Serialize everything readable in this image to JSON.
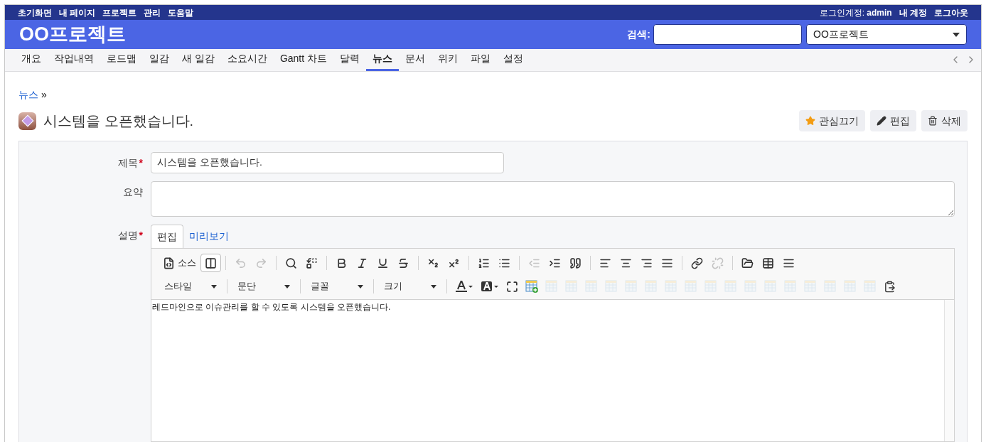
{
  "top_menu": {
    "items": [
      "초기화면",
      "내 페이지",
      "프로젝트",
      "관리",
      "도움말"
    ],
    "login_label": "로그인계정:",
    "login_user": "admin",
    "account_links": [
      "내 계정",
      "로그아웃"
    ]
  },
  "header": {
    "title": "OO프로젝트",
    "search_label": "검색:",
    "project_select": "OO프로젝트"
  },
  "tabs": [
    {
      "label": "개요",
      "selected": false
    },
    {
      "label": "작업내역",
      "selected": false
    },
    {
      "label": "로드맵",
      "selected": false
    },
    {
      "label": "일감",
      "selected": false
    },
    {
      "label": "새 일감",
      "selected": false
    },
    {
      "label": "소요시간",
      "selected": false
    },
    {
      "label": "Gantt 차트",
      "selected": false
    },
    {
      "label": "달력",
      "selected": false
    },
    {
      "label": "뉴스",
      "selected": true
    },
    {
      "label": "문서",
      "selected": false
    },
    {
      "label": "위키",
      "selected": false
    },
    {
      "label": "파일",
      "selected": false
    },
    {
      "label": "설정",
      "selected": false
    }
  ],
  "breadcrumb": {
    "link": "뉴스",
    "separator": "»"
  },
  "page_title": "시스템을 오픈했습니다.",
  "actions": [
    "관심끄기",
    "편집",
    "삭제"
  ],
  "form": {
    "required_mark": "*",
    "title_label": "제목",
    "title_required": true,
    "title_value": "시스템을 오픈했습니다.",
    "summary_label": "요약",
    "summary_required": false,
    "description_label": "설명",
    "description_required": true
  },
  "editor_tabs": [
    {
      "label": "편집",
      "selected": true
    },
    {
      "label": "미리보기",
      "selected": false
    }
  ],
  "toolbar_row_1": [
    {
      "kind": "button",
      "label": "소스",
      "disabled": false,
      "selected": false
    },
    {
      "kind": "button",
      "disabled": false,
      "selected": true
    },
    {
      "kind": "separator"
    },
    {
      "kind": "button",
      "disabled": true,
      "selected": false
    },
    {
      "kind": "button",
      "disabled": true,
      "selected": false
    },
    {
      "kind": "separator"
    },
    {
      "kind": "button",
      "disabled": false,
      "selected": false
    },
    {
      "kind": "button",
      "disabled": false,
      "selected": false
    },
    {
      "kind": "separator"
    },
    {
      "kind": "button",
      "disabled": false,
      "selected": false
    },
    {
      "kind": "button",
      "disabled": false,
      "selected": false
    },
    {
      "kind": "button",
      "disabled": false,
      "selected": false
    },
    {
      "kind": "button",
      "disabled": false,
      "selected": false
    },
    {
      "kind": "separator"
    },
    {
      "kind": "button",
      "disabled": false,
      "selected": false
    },
    {
      "kind": "button",
      "disabled": false,
      "selected": false
    },
    {
      "kind": "separator"
    },
    {
      "kind": "button",
      "disabled": false,
      "selected": false
    },
    {
      "kind": "button",
      "disabled": false,
      "selected": false
    },
    {
      "kind": "separator"
    },
    {
      "kind": "button",
      "disabled": true,
      "selected": false
    },
    {
      "kind": "button",
      "disabled": false,
      "selected": false
    },
    {
      "kind": "button",
      "disabled": false,
      "selected": false
    },
    {
      "kind": "separator"
    },
    {
      "kind": "button",
      "disabled": false,
      "selected": false
    },
    {
      "kind": "button",
      "disabled": false,
      "selected": false
    },
    {
      "kind": "button",
      "disabled": false,
      "selected": false
    },
    {
      "kind": "button",
      "disabled": false,
      "selected": false
    },
    {
      "kind": "separator"
    },
    {
      "kind": "button",
      "disabled": false,
      "selected": false
    },
    {
      "kind": "button",
      "disabled": true,
      "selected": false
    },
    {
      "kind": "separator"
    },
    {
      "kind": "button",
      "disabled": false,
      "selected": false
    },
    {
      "kind": "button",
      "disabled": false,
      "selected": false
    },
    {
      "kind": "button",
      "disabled": false,
      "selected": false
    }
  ],
  "toolbar_row_2": [
    {
      "kind": "dropdown",
      "label": "스타일"
    },
    {
      "kind": "dropdown",
      "label": "문단"
    },
    {
      "kind": "dropdown",
      "label": "글꼴"
    },
    {
      "kind": "dropdown",
      "label": "크기"
    },
    {
      "kind": "separator"
    },
    {
      "kind": "button",
      "disabled": false
    },
    {
      "kind": "button",
      "disabled": false
    },
    {
      "kind": "button",
      "disabled": false
    },
    {
      "kind": "button",
      "disabled": false
    },
    {
      "kind": "button",
      "disabled": true
    },
    {
      "kind": "button",
      "disabled": true
    },
    {
      "kind": "button",
      "disabled": true
    },
    {
      "kind": "button",
      "disabled": true
    },
    {
      "kind": "button",
      "disabled": true
    },
    {
      "kind": "button",
      "disabled": true
    },
    {
      "kind": "button",
      "disabled": true
    },
    {
      "kind": "button",
      "disabled": true
    },
    {
      "kind": "button",
      "disabled": true
    },
    {
      "kind": "button",
      "disabled": true
    },
    {
      "kind": "button",
      "disabled": true
    },
    {
      "kind": "button",
      "disabled": true
    },
    {
      "kind": "button",
      "disabled": true
    },
    {
      "kind": "button",
      "disabled": true
    },
    {
      "kind": "button",
      "disabled": true
    },
    {
      "kind": "button",
      "disabled": true
    },
    {
      "kind": "button",
      "disabled": true
    },
    {
      "kind": "button",
      "disabled": false
    }
  ],
  "editor_content": "레드마인으로 이슈관리를 할 수 있도록 시스템을 오픈했습니다."
}
